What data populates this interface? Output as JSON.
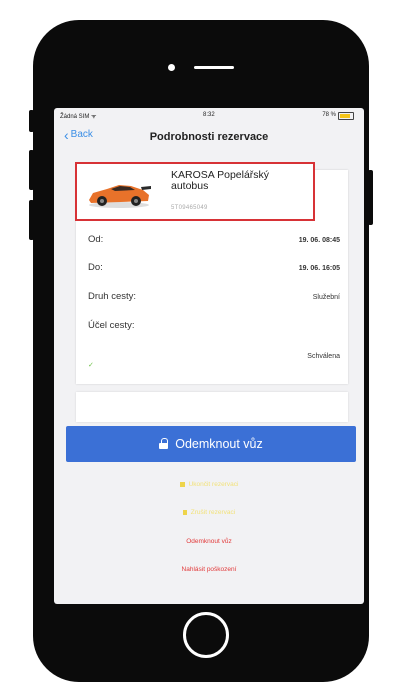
{
  "status_bar": {
    "carrier": "Žádná SIM ᯤ",
    "time": "8:32",
    "battery": "78 %"
  },
  "nav": {
    "back_label": "Back",
    "title": "Podrobnosti rezervace"
  },
  "vehicle": {
    "name": "KAROSA Popelářský autobus",
    "plate": "5T09465049",
    "image_icon": "orange-sports-car-image"
  },
  "details": [
    {
      "label": "Od:",
      "value": "19. 06. 08:45"
    },
    {
      "label": "Do:",
      "value": "19. 06. 16:05"
    },
    {
      "label": "Druh cesty:",
      "value": "Služební"
    },
    {
      "label": "Účel cesty:",
      "value": ""
    }
  ],
  "status": {
    "check_icon": "check-icon",
    "value": "Schválena"
  },
  "actions": {
    "unlock_label": "Odemknout vůz",
    "cancel_label": "Ukončit rezervaci",
    "delete_label": "Zrušit rezervaci",
    "unlock_link_label": "Odemknout vůz",
    "report_damage_label": "Nahlásit poškození"
  },
  "colors": {
    "accent": "#3b70d6",
    "highlight_border": "#d73236",
    "warning_text": "#f2e27a",
    "danger_text": "#e23a3a"
  }
}
